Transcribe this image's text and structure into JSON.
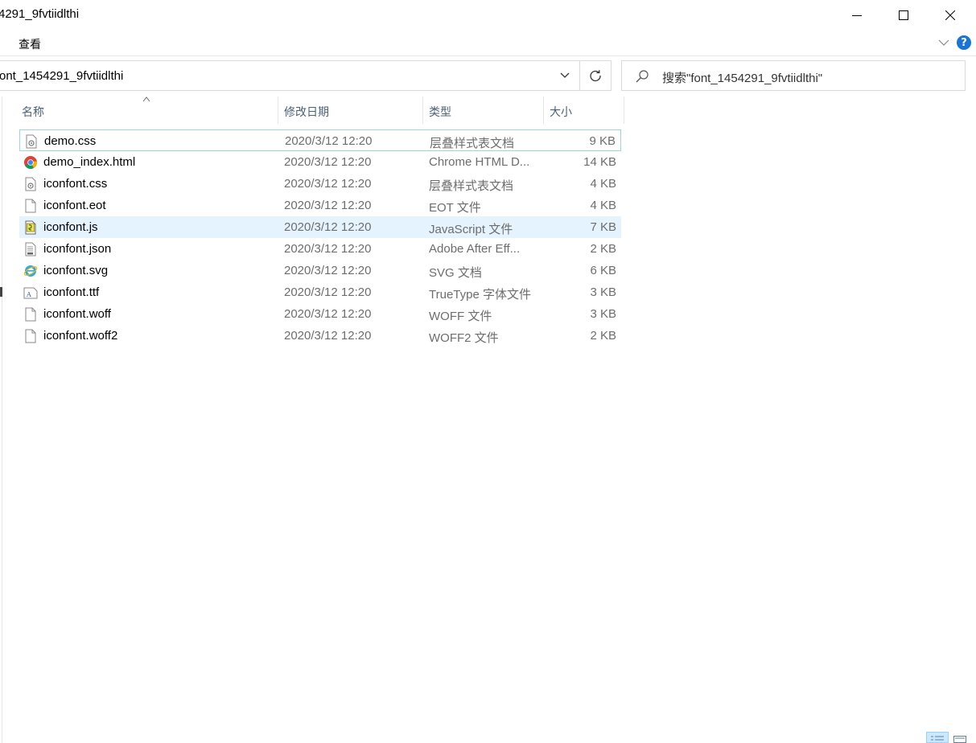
{
  "window": {
    "title": "4291_9fvtiidlthi",
    "controls": [
      "minimize",
      "maximize",
      "close"
    ]
  },
  "menu": {
    "view_label": "查看"
  },
  "address": {
    "path_text": "ont_1454291_9fvtiidlthi"
  },
  "search": {
    "placeholder": "搜索\"font_1454291_9fvtiidlthi\""
  },
  "columns": {
    "name": "名称",
    "modified": "修改日期",
    "type": "类型",
    "size": "大小",
    "sort_column": "名称",
    "sort_direction": "ascending"
  },
  "files": [
    {
      "name": "demo.css",
      "date": "2020/3/12 12:20",
      "type": "层叠样式表文档",
      "size": "9 KB",
      "icon": "css-file-icon"
    },
    {
      "name": "demo_index.html",
      "date": "2020/3/12 12:20",
      "type": "Chrome HTML D...",
      "size": "14 KB",
      "icon": "chrome-icon"
    },
    {
      "name": "iconfont.css",
      "date": "2020/3/12 12:20",
      "type": "层叠样式表文档",
      "size": "4 KB",
      "icon": "css-file-icon"
    },
    {
      "name": "iconfont.eot",
      "date": "2020/3/12 12:20",
      "type": "EOT 文件",
      "size": "4 KB",
      "icon": "blank-file-icon"
    },
    {
      "name": "iconfont.js",
      "date": "2020/3/12 12:20",
      "type": "JavaScript 文件",
      "size": "7 KB",
      "icon": "js-file-icon"
    },
    {
      "name": "iconfont.json",
      "date": "2020/3/12 12:20",
      "type": "Adobe After Eff...",
      "size": "2 KB",
      "icon": "json-file-icon"
    },
    {
      "name": "iconfont.svg",
      "date": "2020/3/12 12:20",
      "type": "SVG 文档",
      "size": "6 KB",
      "icon": "ie-svg-icon"
    },
    {
      "name": "iconfont.ttf",
      "date": "2020/3/12 12:20",
      "type": "TrueType 字体文件",
      "size": "3 KB",
      "icon": "font-file-icon"
    },
    {
      "name": "iconfont.woff",
      "date": "2020/3/12 12:20",
      "type": "WOFF 文件",
      "size": "3 KB",
      "icon": "blank-file-icon"
    },
    {
      "name": "iconfont.woff2",
      "date": "2020/3/12 12:20",
      "type": "WOFF2 文件",
      "size": "2 KB",
      "icon": "blank-file-icon"
    }
  ],
  "state": {
    "focused_file": "demo.css",
    "hovered_file": "iconfont.js",
    "view_mode": "details"
  },
  "colors": {
    "accent": "#1a73d9",
    "hover": "#e5f3ff",
    "focus_border": "#99d1ff",
    "header_text": "#4c607a",
    "secondary_text": "#6d6d6d"
  }
}
